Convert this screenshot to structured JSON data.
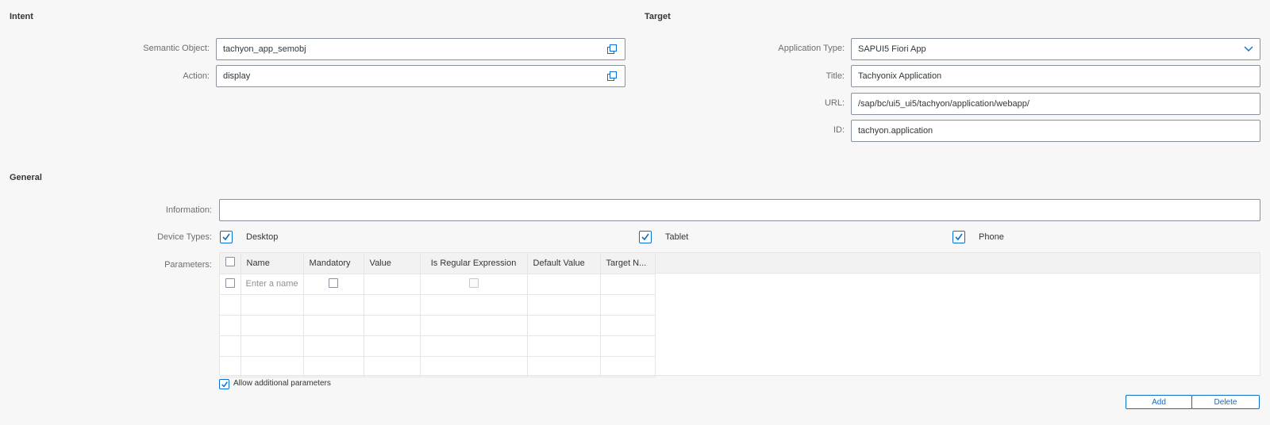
{
  "intent": {
    "title": "Intent",
    "semantic_object_label": "Semantic Object:",
    "semantic_object_value": "tachyon_app_semobj",
    "action_label": "Action:",
    "action_value": "display"
  },
  "target": {
    "title": "Target",
    "app_type_label": "Application Type:",
    "app_type_value": "SAPUI5 Fiori App",
    "title_label": "Title:",
    "title_value": "Tachyonix Application",
    "url_label": "URL:",
    "url_value": "/sap/bc/ui5_ui5/tachyon/application/webapp/",
    "id_label": "ID:",
    "id_value": "tachyon.application"
  },
  "general": {
    "title": "General",
    "information_label": "Information:",
    "information_value": "",
    "device_types_label": "Device Types:",
    "devices": [
      {
        "label": "Desktop",
        "checked": true
      },
      {
        "label": "Tablet",
        "checked": true
      },
      {
        "label": "Phone",
        "checked": true
      }
    ],
    "parameters_label": "Parameters:",
    "columns": [
      "Name",
      "Mandatory",
      "Value",
      "Is Regular Expression",
      "Default Value",
      "Target N..."
    ],
    "name_placeholder": "Enter a name",
    "allow_additional_label": "Allow additional parameters",
    "allow_additional_checked": true
  },
  "buttons": {
    "add_label": "Add",
    "delete_label": "Delete"
  },
  "colors": {
    "accent": "#0a6ed1",
    "background": "#f7f7f7",
    "border": "#89919a"
  }
}
